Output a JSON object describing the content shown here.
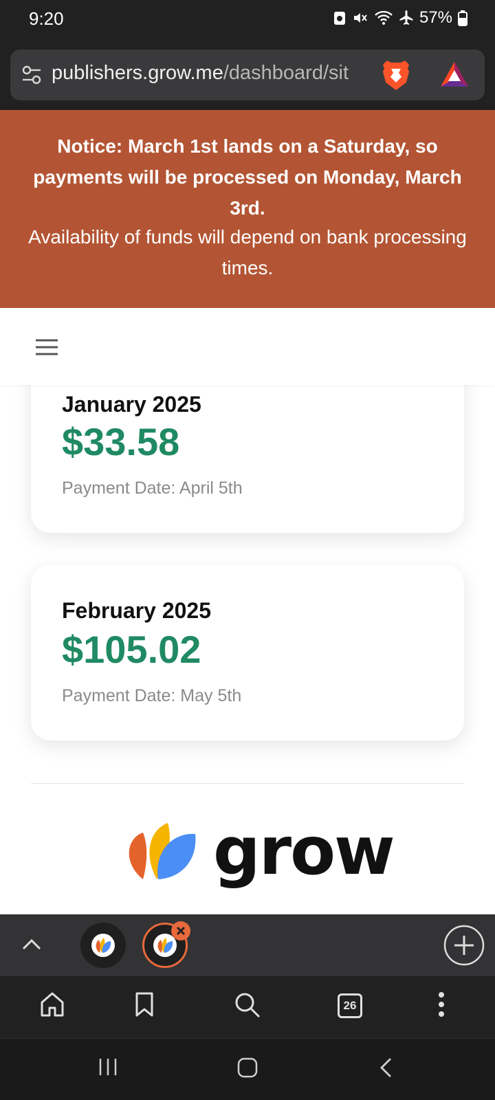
{
  "status_bar": {
    "time": "9:20",
    "battery": "57%",
    "icons": [
      "cat-icon",
      "mute-icon",
      "wifi-icon",
      "airplane-icon",
      "battery-icon"
    ]
  },
  "browser": {
    "url_host": "publishers.grow.me",
    "url_path": "/dashboard/sit",
    "icons": [
      "tune-icon",
      "brave-lion-icon",
      "bat-rewards-icon"
    ]
  },
  "notice": {
    "bold_text": "Notice: March 1st lands on a Saturday, so payments will be processed on Monday, March 3rd.",
    "regular_text": "Availability of funds will depend on bank processing times."
  },
  "earnings": [
    {
      "month": "January 2025",
      "amount": "$33.58",
      "payment_date": "Payment Date: April 5th"
    },
    {
      "month": "February 2025",
      "amount": "$105.02",
      "payment_date": "Payment Date: May 5th"
    }
  ],
  "footer": {
    "logo_text": "grow"
  },
  "tab_strip": {
    "open_tabs": 2
  },
  "toolbar": {
    "tab_count": "26"
  },
  "colors": {
    "notice_bg": "#b35534",
    "amount_green": "#1f8a63",
    "brave_orange": "#e8693c",
    "logo_orange": "#e4622c",
    "logo_yellow": "#f5b400",
    "logo_blue": "#4b8ef5"
  }
}
